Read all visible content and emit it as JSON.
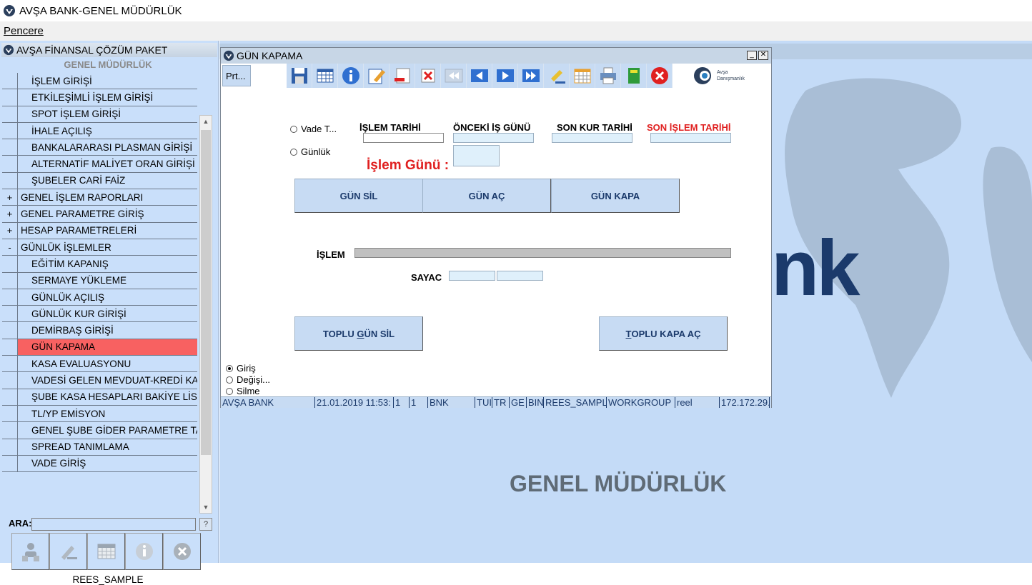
{
  "window": {
    "title": "AVŞA BANK-GENEL MÜDÜRLÜK"
  },
  "menubar": {
    "items": [
      {
        "label": "Pencere"
      }
    ]
  },
  "left_panel": {
    "header": "AVŞA FİNANSAL ÇÖZÜM PAKET",
    "subheader": "GENEL MÜDÜRLÜK",
    "tree": [
      {
        "gutter": "",
        "label": "İŞLEM GİRİŞİ",
        "child": true
      },
      {
        "gutter": "",
        "label": "ETKİLEŞİMLİ İŞLEM GİRİŞİ",
        "child": true
      },
      {
        "gutter": "",
        "label": "SPOT İŞLEM GİRİŞİ",
        "child": true
      },
      {
        "gutter": "",
        "label": "İHALE AÇILIŞ",
        "child": true
      },
      {
        "gutter": "",
        "label": "BANKALARARASI PLASMAN GİRİŞİ",
        "child": true
      },
      {
        "gutter": "",
        "label": "ALTERNATİF MALİYET ORAN GİRİŞİ",
        "child": true
      },
      {
        "gutter": "",
        "label": "ŞUBELER CARİ FAİZ",
        "child": true
      },
      {
        "gutter": "+",
        "label": "GENEL İŞLEM RAPORLARI",
        "child": false
      },
      {
        "gutter": "+",
        "label": "GENEL PARAMETRE GİRİŞ",
        "child": false
      },
      {
        "gutter": "+",
        "label": "HESAP PARAMETRELERİ",
        "child": false
      },
      {
        "gutter": "-",
        "label": "GÜNLÜK İŞLEMLER",
        "child": false
      },
      {
        "gutter": "",
        "label": "EĞİTİM KAPANIŞ",
        "child": true
      },
      {
        "gutter": "",
        "label": "SERMAYE YÜKLEME",
        "child": true
      },
      {
        "gutter": "",
        "label": "GÜNLÜK AÇILIŞ",
        "child": true
      },
      {
        "gutter": "",
        "label": "GÜNLÜK KUR GİRİŞİ",
        "child": true
      },
      {
        "gutter": "",
        "label": "DEMİRBAŞ GİRİŞİ",
        "child": true
      },
      {
        "gutter": "",
        "label": "GÜN KAPAMA",
        "child": true,
        "selected": true
      },
      {
        "gutter": "",
        "label": "KASA EVALUASYONU",
        "child": true
      },
      {
        "gutter": "",
        "label": "VADESİ GELEN MEVDUAT-KREDİ KA",
        "child": true
      },
      {
        "gutter": "",
        "label": "ŞUBE KASA HESAPLARI BAKİYE LİST",
        "child": true
      },
      {
        "gutter": "",
        "label": "TL/YP EMİSYON",
        "child": true
      },
      {
        "gutter": "",
        "label": "GENEL ŞUBE GİDER PARAMETRE TA",
        "child": true
      },
      {
        "gutter": "",
        "label": "SPREAD TANIMLAMA",
        "child": true
      },
      {
        "gutter": "",
        "label": "VADE GİRİŞ",
        "child": true
      }
    ],
    "search_label": "ARA:",
    "search_value": "",
    "help_label": "?",
    "tool_icons": [
      "users-icon",
      "pen-icon",
      "calendar-icon",
      "info-icon",
      "close-icon"
    ],
    "user": "REES_SAMPLE"
  },
  "desktop": {
    "brand_text": "GENEL MÜDÜRLÜK",
    "logo_fragment": "nk"
  },
  "child_window": {
    "title": "GÜN KAPAMA",
    "toolbar": {
      "prt_label": "Prt...",
      "icons": [
        "save-icon",
        "grid-icon",
        "info-icon",
        "edit-icon",
        "delete-record-icon",
        "cancel-icon",
        "first-icon",
        "prev-icon",
        "next-icon",
        "last-icon",
        "clear-icon",
        "calendar-icon",
        "print-icon",
        "book-icon",
        "exit-icon"
      ],
      "logo_line1": "Avşa",
      "logo_line2": "Danışmanlık"
    },
    "form": {
      "radio_vade": "Vade T...",
      "radio_gunluk": "Günlük",
      "hdr_islem_tarihi": "İŞLEM TARİHİ",
      "hdr_onceki_is_gunu": "ÖNCEKİ İŞ GÜNÜ",
      "hdr_son_kur_tarihi": "SON KUR TARİHİ",
      "hdr_son_islem_tarihi": "SON İŞLEM TARİHİ",
      "islem_tarihi": "",
      "onceki_is_gunu": "",
      "son_kur_tarihi": "",
      "son_islem_tarihi": "",
      "islem_gunu_label": "İşlem Günü :",
      "btn_gun_sil": "GÜN SİL",
      "btn_gun_ac": "GÜN AÇ",
      "btn_gun_kapa": "GÜN KAPA",
      "islem_label": "İŞLEM",
      "sayac_label": "SAYAC",
      "btn_toplu_gun_sil_pre": "TOPLU ",
      "btn_toplu_gun_sil_u": "G",
      "btn_toplu_gun_sil_post": "ÜN SİL",
      "btn_toplu_kapa_ac_u": "T",
      "btn_toplu_kapa_ac_post": "OPLU KAPA AÇ",
      "mode_giris": "Giriş",
      "mode_degisi": "Değişi...",
      "mode_silme": "Silme"
    },
    "status": [
      "AVŞA BANK",
      "21.01.2019 11:53:",
      "1",
      "1",
      "BNK",
      "TUI",
      "TR",
      "GE",
      "BIN",
      "REES_SAMPL",
      "WORKGROUP",
      "reel",
      "172.172.29."
    ]
  }
}
